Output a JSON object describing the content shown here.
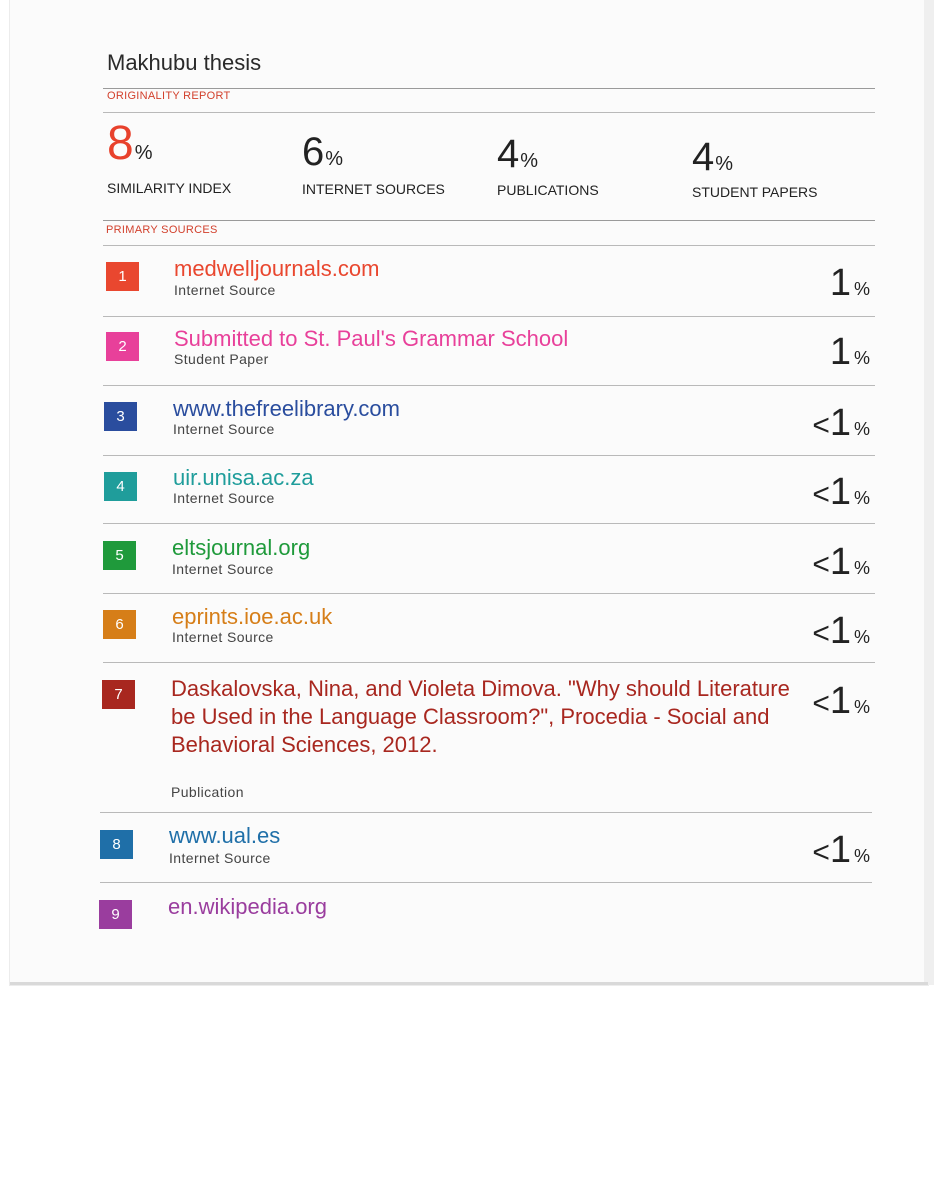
{
  "report": {
    "title": "Makhubu thesis",
    "originality_label": "ORIGINALITY REPORT",
    "primary_label": "PRIMARY SOURCES"
  },
  "stats": [
    {
      "value": "8",
      "unit": "%",
      "label": "SIMILARITY INDEX",
      "color": "#e8412c"
    },
    {
      "value": "6",
      "unit": "%",
      "label": "INTERNET SOURCES",
      "color": "#222222"
    },
    {
      "value": "4",
      "unit": "%",
      "label": "PUBLICATIONS",
      "color": "#222222"
    },
    {
      "value": "4",
      "unit": "%",
      "label": "STUDENT PAPERS",
      "color": "#222222"
    }
  ],
  "sources": [
    {
      "rank": "1",
      "name": "medwelljournals.com",
      "type": "Internet Source",
      "prefix": "",
      "percent": "1",
      "unit": "%",
      "color": "#e9472f"
    },
    {
      "rank": "2",
      "name": "Submitted to St. Paul's Grammar School",
      "type": "Student Paper",
      "prefix": "",
      "percent": "1",
      "unit": "%",
      "color": "#e8409a"
    },
    {
      "rank": "3",
      "name": "www.thefreelibrary.com",
      "type": "Internet Source",
      "prefix": "<",
      "percent": "1",
      "unit": "%",
      "color": "#2a4d9e"
    },
    {
      "rank": "4",
      "name": "uir.unisa.ac.za",
      "type": "Internet Source",
      "prefix": "<",
      "percent": "1",
      "unit": "%",
      "color": "#1f9d9b"
    },
    {
      "rank": "5",
      "name": "eltsjournal.org",
      "type": "Internet Source",
      "prefix": "<",
      "percent": "1",
      "unit": "%",
      "color": "#1f9a3b"
    },
    {
      "rank": "6",
      "name": "eprints.ioe.ac.uk",
      "type": "Internet Source",
      "prefix": "<",
      "percent": "1",
      "unit": "%",
      "color": "#d67e18"
    },
    {
      "rank": "7",
      "name": "Daskalovska, Nina, and Violeta Dimova. \"Why should Literature be Used in the Language Classroom?\", Procedia - Social and Behavioral Sciences, 2012.",
      "type": "Publication",
      "prefix": "<",
      "percent": "1",
      "unit": "%",
      "color": "#a8271f"
    },
    {
      "rank": "8",
      "name": "www.ual.es",
      "type": "Internet Source",
      "prefix": "<",
      "percent": "1",
      "unit": "%",
      "color": "#1f6fa8"
    },
    {
      "rank": "9",
      "name": "en.wikipedia.org",
      "type": "",
      "prefix": "",
      "percent": "",
      "unit": "",
      "color": "#9a3d9e"
    }
  ]
}
